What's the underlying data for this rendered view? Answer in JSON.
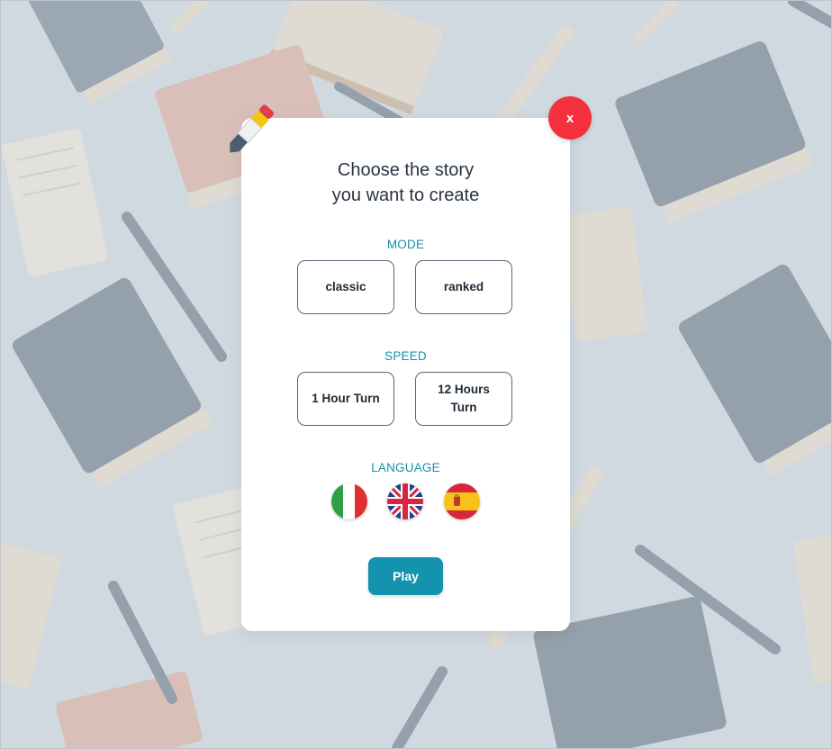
{
  "dialog": {
    "title_line1": "Choose the story",
    "title_line2": "you want to create",
    "close_label": "x"
  },
  "mode": {
    "label": "MODE",
    "options": [
      "classic",
      "ranked"
    ]
  },
  "speed": {
    "label": "SPEED",
    "options": [
      "1 Hour Turn",
      "12 Hours Turn"
    ]
  },
  "language": {
    "label": "LANGUAGE",
    "flags": [
      "italy-flag-icon",
      "uk-flag-icon",
      "spain-flag-icon"
    ]
  },
  "play_label": "Play",
  "colors": {
    "accent": "#1393ad",
    "close": "#f4303e",
    "section_label": "#168fa5",
    "background": "#d3dae1"
  }
}
